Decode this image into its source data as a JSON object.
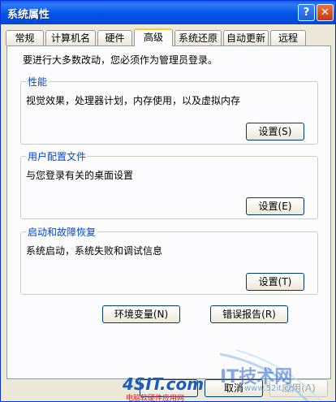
{
  "window": {
    "title": "系统属性"
  },
  "titlebar": {
    "help": "?",
    "close": "✕"
  },
  "tabs": [
    {
      "label": "常规"
    },
    {
      "label": "计算机名"
    },
    {
      "label": "硬件"
    },
    {
      "label": "高级"
    },
    {
      "label": "系统还原"
    },
    {
      "label": "自动更新"
    },
    {
      "label": "远程"
    }
  ],
  "notice": "要进行大多数改动，您必须作为管理员登录。",
  "groups": {
    "performance": {
      "title": "性能",
      "desc": "视觉效果，处理器计划，内存使用，以及虚拟内存",
      "button": "设置(S)"
    },
    "profiles": {
      "title": "用户配置文件",
      "desc": "与您登录有关的桌面设置",
      "button": "设置(E)"
    },
    "startup": {
      "title": "启动和故障恢复",
      "desc": "系统启动，系统失败和调试信息",
      "button": "设置(T)"
    }
  },
  "buttons": {
    "env": "环境变量(N)",
    "error": "错误报告(R)"
  },
  "footer": {
    "ok": "",
    "cancel": "取消",
    "apply": "应用(A)"
  },
  "watermark": {
    "site1": "4SIT.com",
    "site1_sub": "电脑软硬件应用网",
    "site2": "IT技术网",
    "site2_url": "www.52it.cc"
  }
}
